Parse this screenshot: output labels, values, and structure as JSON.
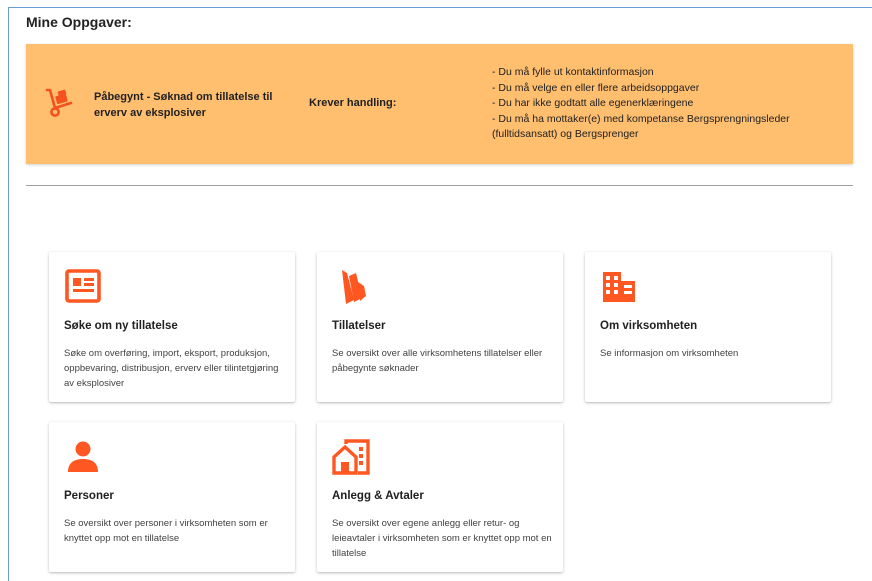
{
  "page": {
    "title": "Mine Oppgaver:"
  },
  "task": {
    "title": "Påbegynt - Søknad om tillatelse til erverv av eksplosiver",
    "status_label": "Krever handling:",
    "requirements": [
      "- Du må fylle ut kontaktinformasjon",
      "- Du må velge en eller flere arbeidsoppgaver",
      "- Du har ikke godtatt alle egenerklæringene",
      "- Du må ha mottaker(e) med kompetanse Bergsprengningsleder (fulltidsansatt) og Bergsprenger"
    ],
    "icon": "hand-truck-icon",
    "background_color": "#ffbf6f",
    "icon_color": "#f4511e"
  },
  "cards": [
    {
      "title": "Søke om ny tillatelse",
      "description": "Søke om overføring, import, eksport, produksjon, oppbevaring, distribusjon, erverv eller tilintetgjøring av eksplosiver",
      "icon": "article-icon"
    },
    {
      "title": "Tillatelser",
      "description": "Se oversikt over alle virksomhetens tillatelser eller påbegynte søknader",
      "icon": "folders-icon"
    },
    {
      "title": "Om virksomheten",
      "description": "Se informasjon om virksomheten",
      "icon": "business-icon"
    },
    {
      "title": "Personer",
      "description": "Se oversikt over personer i virksomheten som er knyttet opp mot en tillatelse",
      "icon": "person-icon"
    },
    {
      "title": "Anlegg & Avtaler",
      "description": "Se oversikt over egene anlegg eller retur- og leieavtaler i virksomheten som er knyttet opp mot en tillatelse",
      "icon": "facility-icon"
    }
  ],
  "colors": {
    "accent": "#ff5722",
    "divider": "#9e9e9e"
  }
}
